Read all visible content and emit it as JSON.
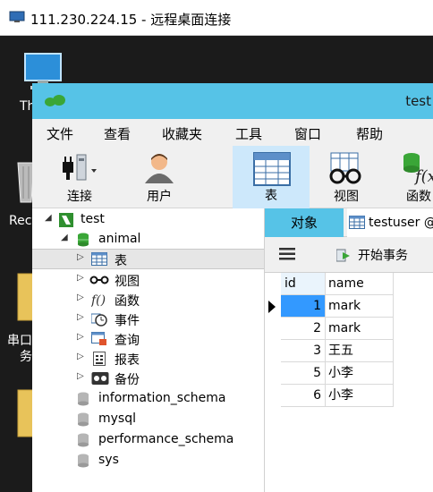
{
  "rdp": {
    "title": "111.230.224.15 - 远程桌面连接"
  },
  "desktop": {
    "icons": [
      {
        "label": "Th",
        "kind": "computer"
      },
      {
        "label": "Recy",
        "kind": "recycle-bin"
      },
      {
        "label": "串口",
        "label2": "务",
        "kind": "folder"
      },
      {
        "label": "",
        "kind": "folder"
      }
    ]
  },
  "navicat": {
    "title": "test",
    "menu": [
      "文件",
      "查看",
      "收藏夹",
      "工具",
      "窗口",
      "帮助"
    ],
    "toolbar": [
      {
        "label": "连接",
        "icon": "plug-icon"
      },
      {
        "label": "用户",
        "icon": "user-icon"
      },
      {
        "label": "表",
        "icon": "table-icon",
        "selected": true
      },
      {
        "label": "视图",
        "icon": "glasses-icon"
      },
      {
        "label": "函数",
        "icon": "function-icon"
      }
    ],
    "tree": {
      "connection": "test",
      "database": "animal",
      "nodes": [
        "表",
        "视图",
        "函数",
        "事件",
        "查询",
        "报表",
        "备份"
      ],
      "other_databases": [
        "information_schema",
        "mysql",
        "performance_schema",
        "sys"
      ]
    },
    "tabs": {
      "objects": "对象",
      "testuser": "testuser @"
    },
    "data_toolbar": {
      "begin_transaction": "开始事务"
    },
    "grid": {
      "columns": [
        "id",
        "name"
      ],
      "rows": [
        {
          "id": "1",
          "name": "mark"
        },
        {
          "id": "2",
          "name": "mark"
        },
        {
          "id": "3",
          "name": "王五"
        },
        {
          "id": "5",
          "name": "小李"
        },
        {
          "id": "6",
          "name": "小李"
        }
      ]
    }
  }
}
